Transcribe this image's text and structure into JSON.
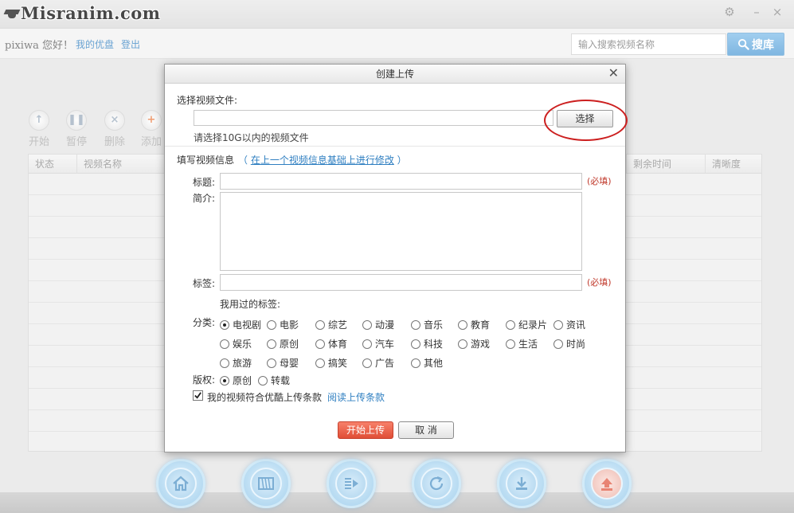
{
  "app": {
    "watermark": "Misranim.com",
    "greeting": "pixiwa 您好！",
    "my_youku": "我的优盘",
    "logout": "登出",
    "search_placeholder": "输入搜索视频名称",
    "search_button": "搜库"
  },
  "toolbar": [
    {
      "label": "开始",
      "icon": "play-icon"
    },
    {
      "label": "暂停",
      "icon": "pause-icon"
    },
    {
      "label": "删除",
      "icon": "delete-icon"
    },
    {
      "label": "添加",
      "icon": "add-icon"
    }
  ],
  "table": {
    "columns": [
      "状态",
      "视频名称",
      "剩余时间",
      "清晰度"
    ]
  },
  "dock": [
    "home-icon",
    "film-icon",
    "video-list-icon",
    "refresh-icon",
    "download-icon",
    "upload-icon"
  ],
  "dialog": {
    "title": "创建上传",
    "select_file_label": "选择视频文件:",
    "choose_button": "选择",
    "file_hint": "请选择10G以内的视频文件",
    "info_label": "填写视频信息",
    "modify_prefix": "（ ",
    "modify_link": "在上一个视频信息基础上进行修改",
    "modify_suffix": " ）",
    "title_label": "标题:",
    "desc_label": "简介:",
    "tags_label": "标签:",
    "required": "(必填)",
    "used_tags_label": "我用过的标签:",
    "category_label": "分类:",
    "categories": [
      {
        "label": "电视剧",
        "selected": true
      },
      {
        "label": "电影",
        "selected": false
      },
      {
        "label": "综艺",
        "selected": false
      },
      {
        "label": "动漫",
        "selected": false
      },
      {
        "label": "音乐",
        "selected": false
      },
      {
        "label": "教育",
        "selected": false
      },
      {
        "label": "纪录片",
        "selected": false
      },
      {
        "label": "资讯",
        "selected": false
      },
      {
        "label": "娱乐",
        "selected": false
      },
      {
        "label": "原创",
        "selected": false
      },
      {
        "label": "体育",
        "selected": false
      },
      {
        "label": "汽车",
        "selected": false
      },
      {
        "label": "科技",
        "selected": false
      },
      {
        "label": "游戏",
        "selected": false
      },
      {
        "label": "生活",
        "selected": false
      },
      {
        "label": "时尚",
        "selected": false
      },
      {
        "label": "旅游",
        "selected": false
      },
      {
        "label": "母婴",
        "selected": false
      },
      {
        "label": "搞笑",
        "selected": false
      },
      {
        "label": "广告",
        "selected": false
      },
      {
        "label": "其他",
        "selected": false
      }
    ],
    "copyright_label": "版权:",
    "copyright_options": [
      {
        "label": "原创",
        "selected": true
      },
      {
        "label": "转载",
        "selected": false
      }
    ],
    "agree_text": "我的视频符合优酷上传条款",
    "agree_checked": true,
    "terms_link": "阅读上传条款",
    "start_button": "开始上传",
    "cancel_button": "取 消"
  },
  "colors": {
    "accent_blue": "#2f7fc1",
    "required_red": "#c0392b",
    "start_button": "#e04e36",
    "annotation_circle": "#cc1f1f"
  }
}
